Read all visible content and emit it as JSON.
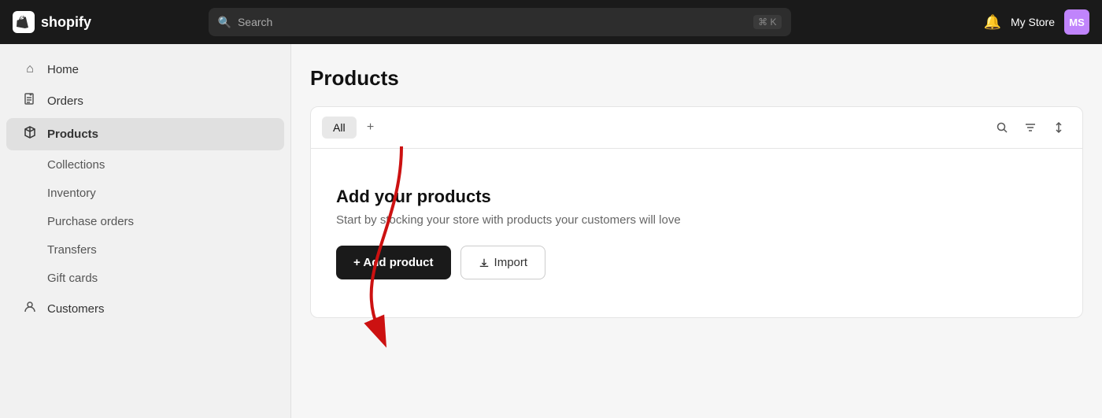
{
  "topbar": {
    "logo_text": "shopify",
    "search_placeholder": "Search",
    "kbd_hint": "⌘ K",
    "bell_icon": "🔔",
    "store_name": "My Store",
    "avatar_initials": "MS",
    "avatar_color": "#c084fc"
  },
  "sidebar": {
    "items": [
      {
        "id": "home",
        "label": "Home",
        "icon": "⌂",
        "active": false,
        "level": 0
      },
      {
        "id": "orders",
        "label": "Orders",
        "icon": "◻",
        "active": false,
        "level": 0
      },
      {
        "id": "products",
        "label": "Products",
        "icon": "◇",
        "active": true,
        "level": 0
      },
      {
        "id": "collections",
        "label": "Collections",
        "active": false,
        "level": 1
      },
      {
        "id": "inventory",
        "label": "Inventory",
        "active": false,
        "level": 1
      },
      {
        "id": "purchase-orders",
        "label": "Purchase orders",
        "active": false,
        "level": 1
      },
      {
        "id": "transfers",
        "label": "Transfers",
        "active": false,
        "level": 1
      },
      {
        "id": "gift-cards",
        "label": "Gift cards",
        "active": false,
        "level": 1
      },
      {
        "id": "customers",
        "label": "Customers",
        "icon": "👤",
        "active": false,
        "level": 0
      }
    ]
  },
  "main": {
    "page_title": "Products",
    "tabs": [
      {
        "id": "all",
        "label": "All",
        "active": true
      }
    ],
    "add_tab_label": "+",
    "empty_state": {
      "title": "Add your products",
      "description": "Start by stocking your store with products your customers will love",
      "add_button": "+ Add product",
      "import_button": "Import"
    }
  }
}
